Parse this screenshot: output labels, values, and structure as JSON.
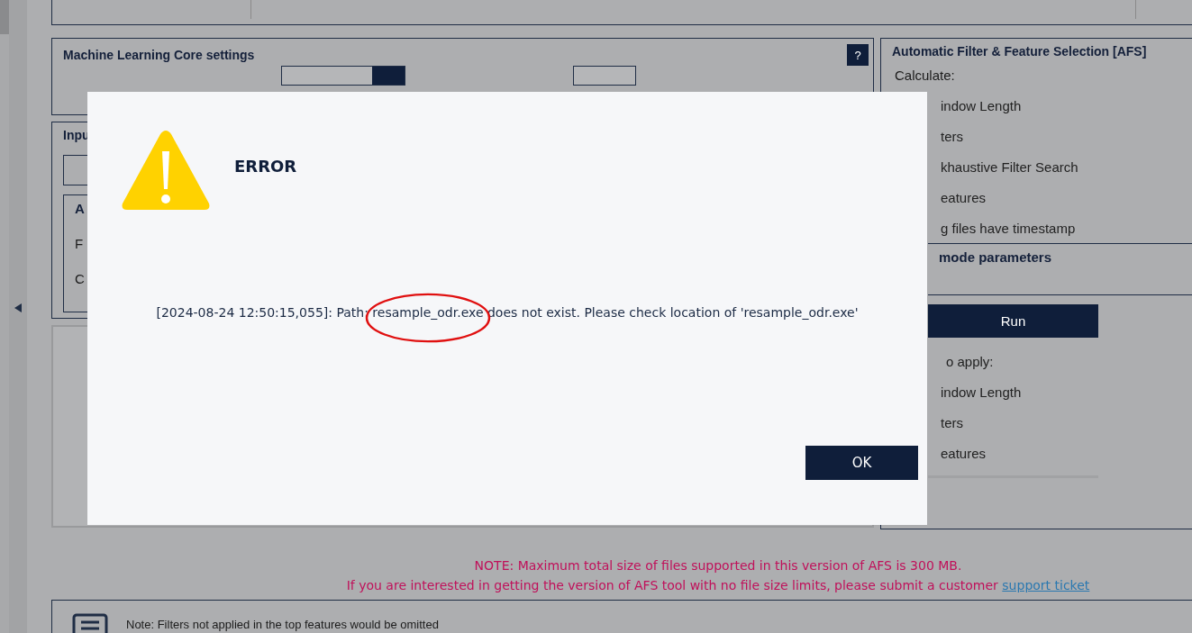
{
  "ml_settings": {
    "title": "Machine Learning Core settings",
    "help_button": "?"
  },
  "input_panel": {
    "title": "Inpu",
    "inner_title": "A",
    "inner_rows": [
      "F",
      "C"
    ]
  },
  "afs": {
    "title": "Automatic Filter & Feature Selection [AFS]",
    "calculate_label": "Calculate:",
    "calculate_items": [
      "indow Length",
      "ters",
      "khaustive Filter Search",
      "eatures",
      "g files have timestamp"
    ],
    "section_title": "mode parameters",
    "run_button": "Run",
    "apply_label": "o apply:",
    "apply_items": [
      "indow Length",
      "ters",
      "eatures"
    ]
  },
  "notes": {
    "size_note": "NOTE: Maximum total size of files supported in this version of AFS is 300 MB.",
    "limit_note": "If you are interested in getting the version of AFS tool with no file size limits, please submit a customer",
    "link": "support ticket"
  },
  "filter_note": "Note: Filters not applied in the top features would be omitted",
  "dialog": {
    "title": "ERROR",
    "message_prefix": "[2024-08-24 12:50:15,055]: Path: ",
    "message_highlight": "resample_odr.exe",
    "message_suffix": " does not exist. Please check location of 'resample_odr.exe'",
    "ok_button": "OK"
  }
}
